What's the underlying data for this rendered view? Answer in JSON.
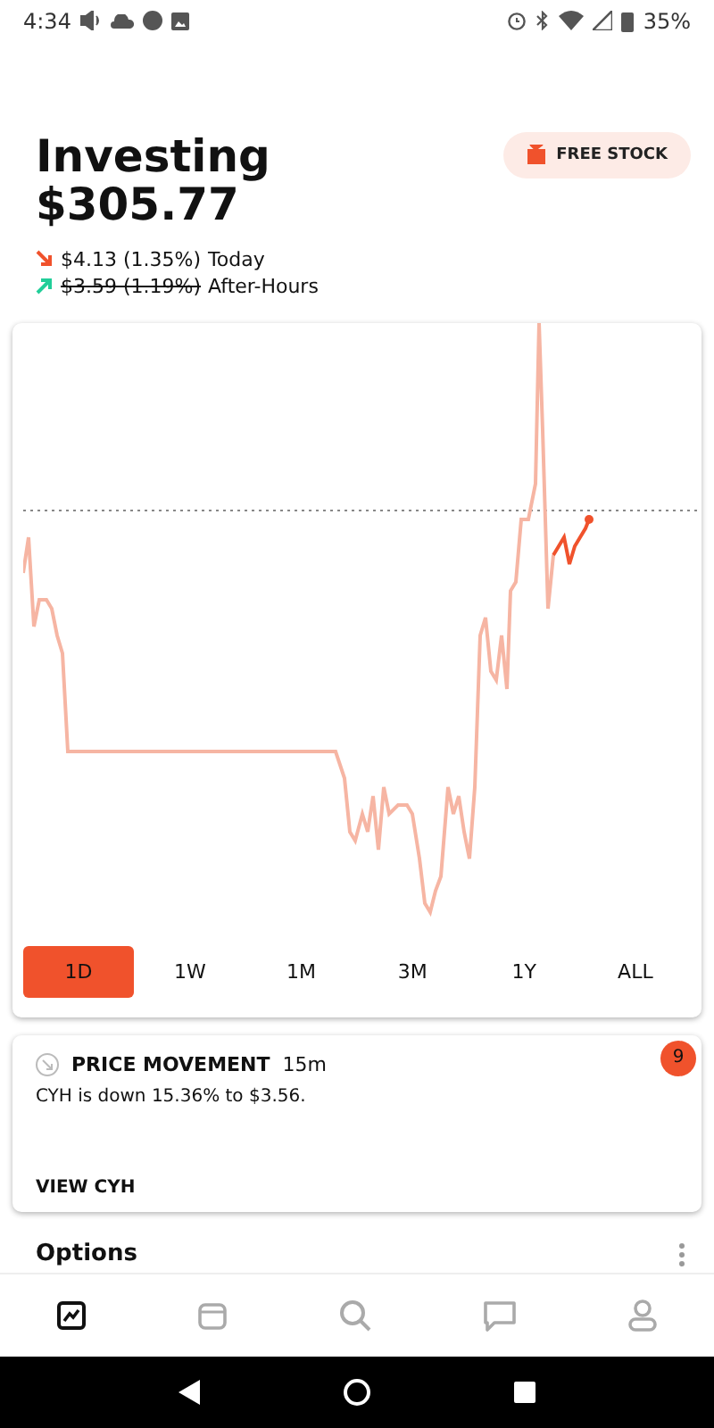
{
  "status_bar": {
    "time": "4:34",
    "battery": "35%"
  },
  "header": {
    "title": "Investing",
    "value": "$305.77",
    "free_stock_button": "FREE STOCK"
  },
  "changes": [
    {
      "kind": "down",
      "amount": "$4.13 (1.35%)",
      "label": "Today",
      "struck": false
    },
    {
      "kind": "up",
      "amount": "$3.59 (1.19%)",
      "label": "After-Hours",
      "struck": true
    }
  ],
  "ranges": [
    {
      "label": "1D",
      "selected": true
    },
    {
      "label": "1W",
      "selected": false
    },
    {
      "label": "1M",
      "selected": false
    },
    {
      "label": "3M",
      "selected": false
    },
    {
      "label": "1Y",
      "selected": false
    },
    {
      "label": "ALL",
      "selected": false
    }
  ],
  "notification": {
    "title": "PRICE MOVEMENT",
    "time": "15m",
    "badge": "9",
    "message": "CYH is down 15.36% to $3.56.",
    "action": "VIEW CYH"
  },
  "section": {
    "title": "Options"
  },
  "bottom_nav": [
    {
      "kind": "chart",
      "selected": true
    },
    {
      "kind": "wallet",
      "selected": false
    },
    {
      "kind": "search",
      "selected": false
    },
    {
      "kind": "chat",
      "selected": false
    },
    {
      "kind": "person",
      "selected": false
    }
  ]
}
